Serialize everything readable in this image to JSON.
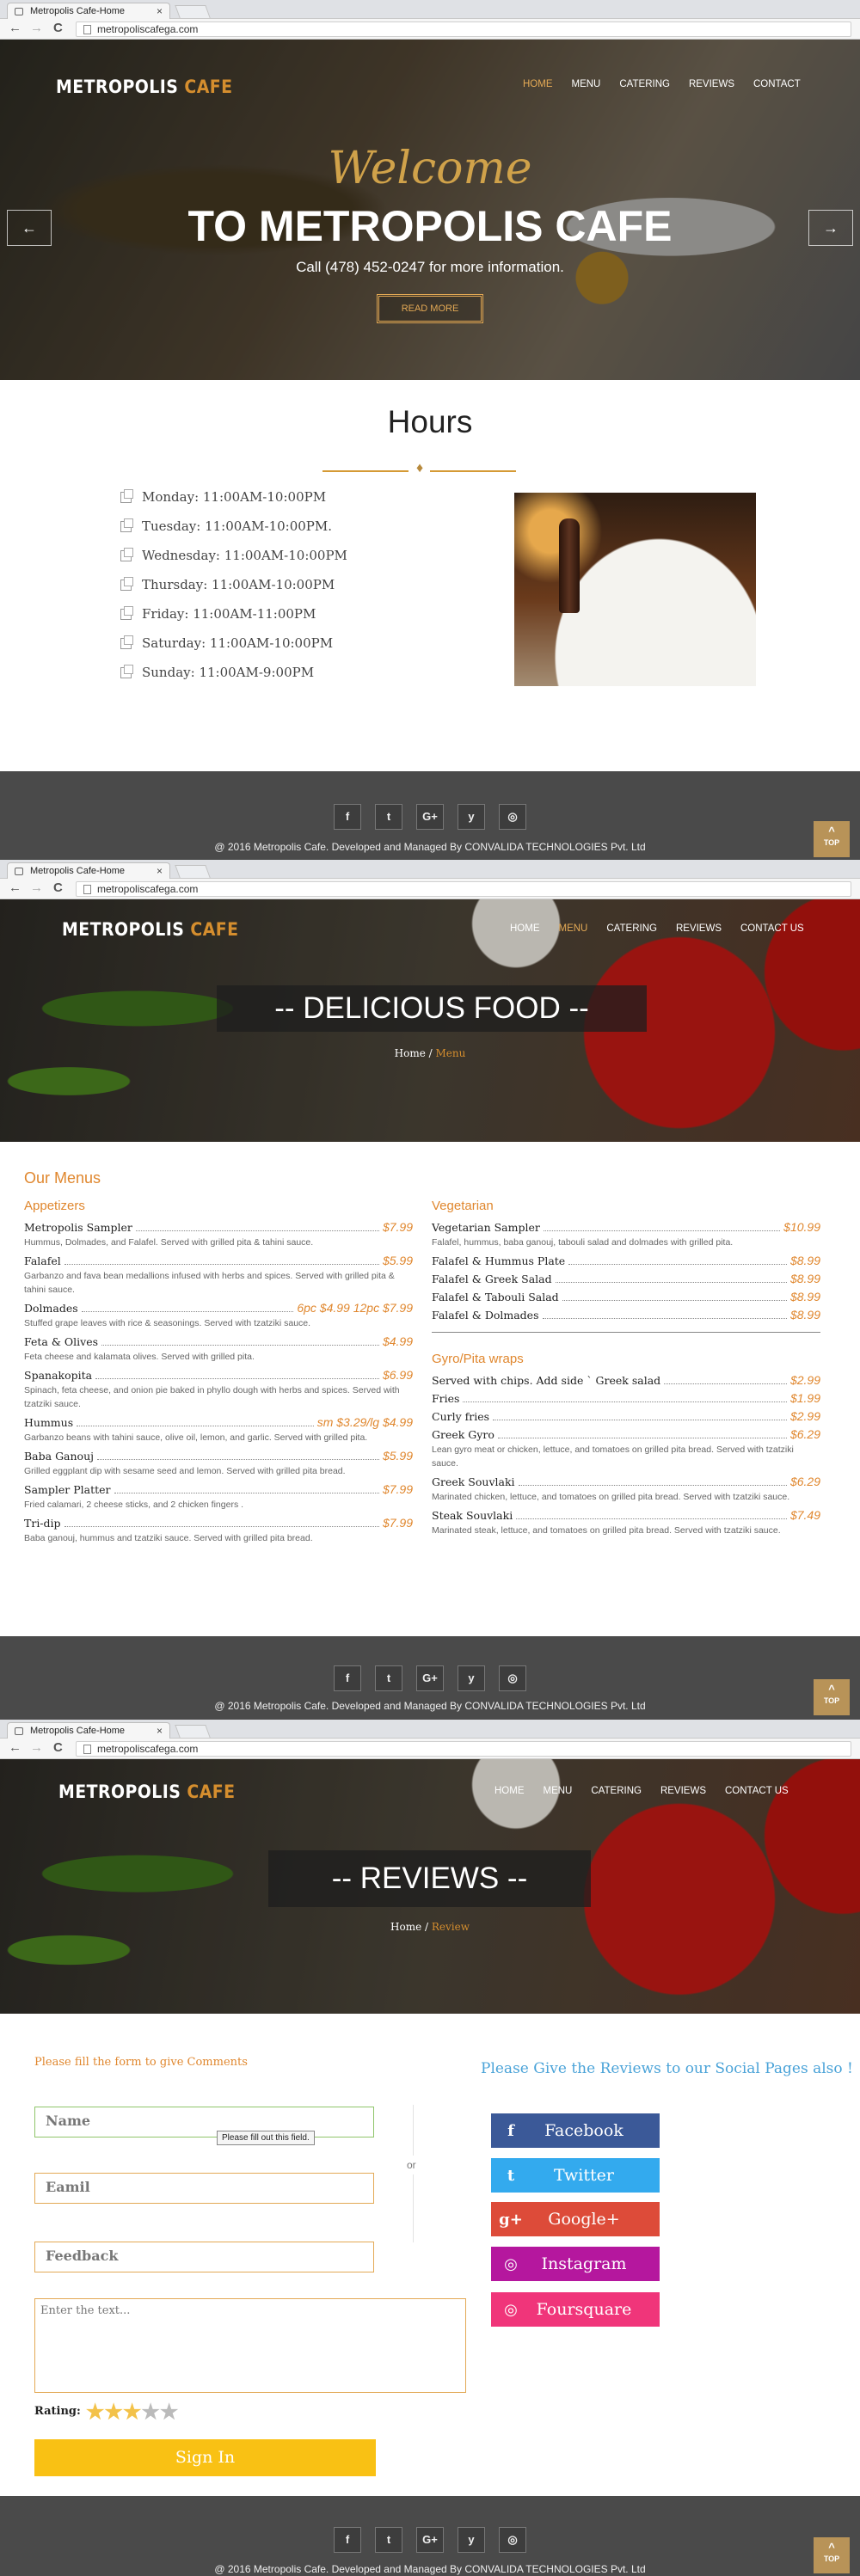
{
  "browser": {
    "tab_title": "Metropolis Cafe-Home",
    "tab_close": "×",
    "url": "metropoliscafega.com",
    "back": "←",
    "forward": "→",
    "reload": "C"
  },
  "brand": {
    "name_white": "METROPOLIS ",
    "name_accent": "CAFE",
    "accent_color": "#d58e2e"
  },
  "nav": {
    "home": "HOME",
    "menu": "MENU",
    "catering": "CATERING",
    "reviews": "REVIEWS",
    "contact": "CONTACT",
    "contact_us": "CONTACT US"
  },
  "home": {
    "welcome": "Welcome",
    "title": "TO METROPOLIS CAFE",
    "phone": "Call (478) 452-0247 for more information.",
    "read_more": "READ MORE",
    "prev": "←",
    "next": "→",
    "hours_title": "Hours",
    "hours": [
      "Monday: 11:00AM-10:00PM",
      "Tuesday: 11:00AM-10:00PM.",
      "Wednesday: 11:00AM-10:00PM",
      "Thursday: 11:00AM-10:00PM",
      "Friday: 11:00AM-11:00PM",
      "Saturday: 11:00AM-10:00PM",
      "Sunday: 11:00AM-9:00PM"
    ]
  },
  "footer": {
    "icons": [
      "f",
      "t",
      "G+",
      "y",
      "◎"
    ],
    "copyright": "@ 2016 Metropolis Cafe. Developed and Managed By CONVALIDA TECHNOLOGIES Pvt. Ltd",
    "top": "TOP"
  },
  "menu_page": {
    "banner": "-- DELICIOUS FOOD --",
    "crumb_home": "Home",
    "crumb_sep": " / ",
    "crumb_current": "Menu",
    "heading": "Our Menus",
    "appetizers_title": "Appetizers",
    "appetizers": [
      {
        "name": "Metropolis Sampler",
        "price": "$7.99",
        "desc": "Hummus, Dolmades, and Falafel. Served with grilled pita & tahini sauce."
      },
      {
        "name": "Falafel",
        "price": "$5.99",
        "desc": "Garbanzo and fava bean medallions infused with herbs and spices. Served with grilled pita & tahini sauce."
      },
      {
        "name": "Dolmades",
        "price": "6pc $4.99 12pc $7.99",
        "desc": "Stuffed grape leaves with rice & seasonings. Served with tzatziki sauce."
      },
      {
        "name": "Feta & Olives",
        "price": "$4.99",
        "desc": "Feta cheese and kalamata olives. Served with grilled pita."
      },
      {
        "name": "Spanakopita",
        "price": "$6.99",
        "desc": "Spinach, feta cheese, and onion pie baked in phyllo dough with herbs and spices. Served with tzatziki sauce."
      },
      {
        "name": "Hummus",
        "price": "sm $3.29/lg $4.99",
        "desc": "Garbanzo beans with tahini sauce, olive oil, lemon, and garlic. Served with grilled pita."
      },
      {
        "name": "Baba Ganouj",
        "price": "$5.99",
        "desc": "Grilled eggplant dip with sesame seed and lemon. Served with grilled pita bread."
      },
      {
        "name": "Sampler Platter",
        "price": "$7.99",
        "desc": "Fried calamari, 2 cheese sticks, and 2 chicken fingers ."
      },
      {
        "name": "Tri-dip",
        "price": "$7.99",
        "desc": "Baba ganouj, hummus and tzatziki sauce. Served with grilled pita bread."
      }
    ],
    "vegetarian_title": "Vegetarian",
    "vegetarian": [
      {
        "name": "Vegetarian Sampler",
        "price": "$10.99",
        "desc": "Falafel, hummus, baba ganouj, tabouli salad and dolmades with grilled pita."
      },
      {
        "name": "Falafel & Hummus Plate",
        "price": "$8.99",
        "desc": ""
      },
      {
        "name": "Falafel & Greek Salad",
        "price": "$8.99",
        "desc": ""
      },
      {
        "name": "Falafel & Tabouli Salad",
        "price": "$8.99",
        "desc": ""
      },
      {
        "name": "Falafel & Dolmades",
        "price": "$8.99",
        "desc": ""
      }
    ],
    "gyro_title": "Gyro/Pita wraps",
    "gyro": [
      {
        "name": "Served with chips. Add side ` Greek salad",
        "price": "$2.99",
        "desc": ""
      },
      {
        "name": "Fries",
        "price": "$1.99",
        "desc": ""
      },
      {
        "name": "Curly fries",
        "price": "$2.99",
        "desc": ""
      },
      {
        "name": "Greek Gyro",
        "price": "$6.29",
        "desc": "Lean gyro meat or chicken, lettuce, and tomatoes on grilled pita bread. Served with tzatziki sauce."
      },
      {
        "name": "Greek Souvlaki",
        "price": "$6.29",
        "desc": "Marinated chicken, lettuce, and tomatoes on grilled pita bread. Served with tzatziki sauce."
      },
      {
        "name": "Steak Souvlaki",
        "price": "$7.49",
        "desc": "Marinated steak, lettuce, and tomatoes on grilled pita bread. Served with tzatziki sauce."
      }
    ]
  },
  "reviews_page": {
    "banner": "-- REVIEWS --",
    "crumb_home": "Home",
    "crumb_sep": " / ",
    "crumb_current": "Review",
    "form_heading": "Please fill the form to give Comments",
    "name_placeholder": "Name",
    "email_placeholder": "Eamil",
    "feedback_placeholder": "Feedback",
    "text_placeholder": "Enter the text...",
    "validation_tip": "Please fill out this field.",
    "or": "or",
    "rating_label": "Rating:",
    "rating_value": 3,
    "rating_max": 5,
    "submit": "Sign In",
    "social_heading": "Please Give the Reviews to our Social Pages also !",
    "social_buttons": [
      {
        "icon": "f",
        "label": "Facebook",
        "color": "#3b5998"
      },
      {
        "icon": "t",
        "label": "Twitter",
        "color": "#33aaee"
      },
      {
        "icon": "g+",
        "label": "Google+",
        "color": "#dd4b39"
      },
      {
        "icon": "◎",
        "label": "Instagram",
        "color": "#b5179e"
      },
      {
        "icon": "◎",
        "label": "Foursquare",
        "color": "#f0357a"
      }
    ]
  }
}
